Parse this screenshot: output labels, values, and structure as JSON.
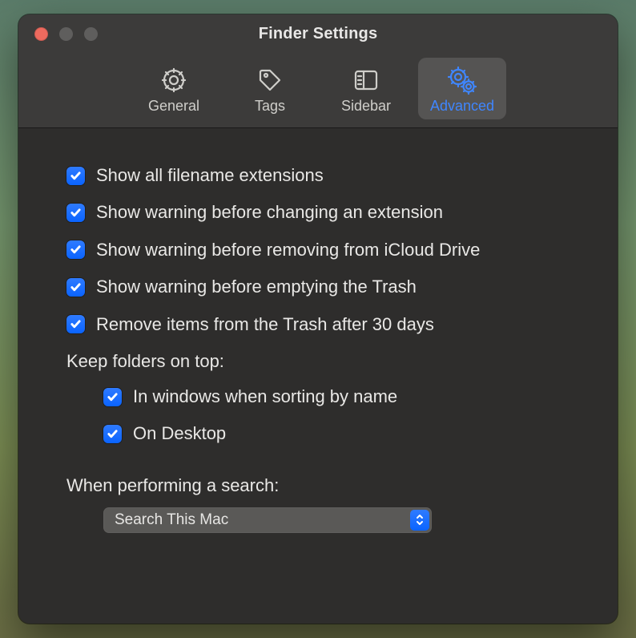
{
  "window": {
    "title": "Finder Settings"
  },
  "toolbar": {
    "tabs": [
      {
        "label": "General"
      },
      {
        "label": "Tags"
      },
      {
        "label": "Sidebar"
      },
      {
        "label": "Advanced"
      }
    ]
  },
  "checks": {
    "show_extensions": "Show all filename extensions",
    "warn_change_ext": "Show warning before changing an extension",
    "warn_icloud_remove": "Show warning before removing from iCloud Drive",
    "warn_empty_trash": "Show warning before emptying the Trash",
    "trash_30_days": "Remove items from the Trash after 30 days",
    "keep_on_top_label": "Keep folders on top:",
    "keep_windows_sort": "In windows when sorting by name",
    "keep_on_desktop": "On Desktop",
    "search_label": "When performing a search:"
  },
  "search_select": {
    "value": "Search This Mac"
  }
}
